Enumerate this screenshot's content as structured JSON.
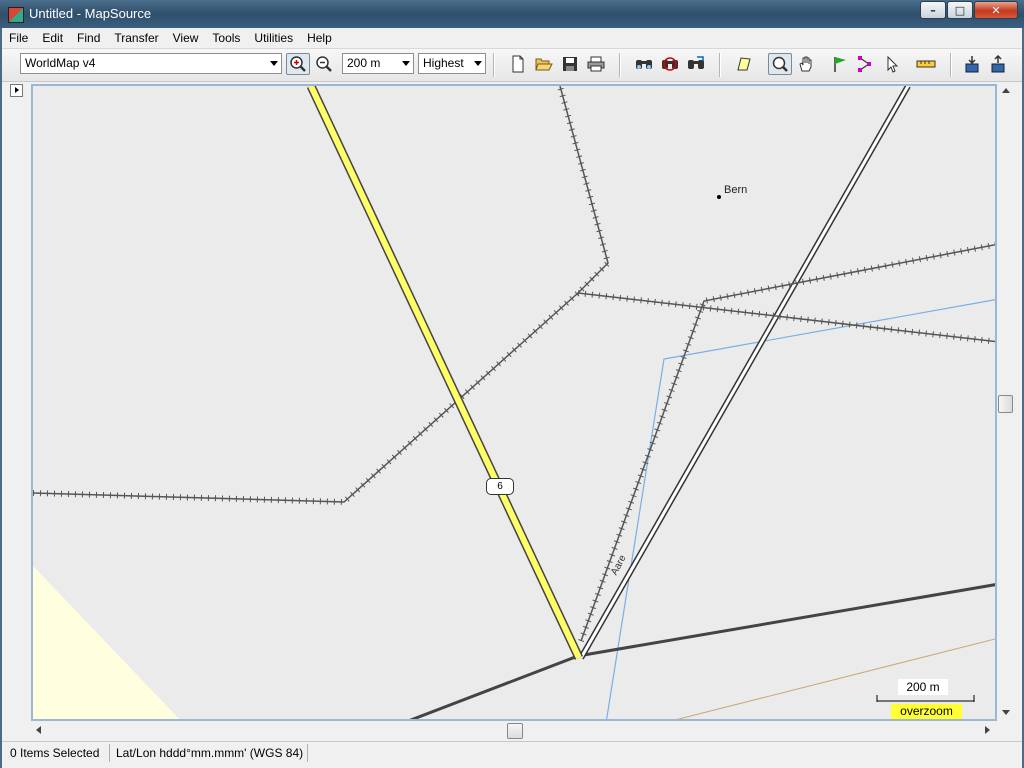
{
  "window": {
    "title": "Untitled - MapSource",
    "min_label": "–",
    "max_label": "□",
    "close_label": "✕"
  },
  "menu": {
    "items": [
      "File",
      "Edit",
      "Find",
      "Transfer",
      "View",
      "Tools",
      "Utilities",
      "Help"
    ]
  },
  "toolbar": {
    "product": "WorldMap v4",
    "zoom_scale": "200 m",
    "detail": "Highest",
    "icons": [
      "zoom-in-icon",
      "zoom-out-icon",
      "new-file-icon",
      "open-folder-icon",
      "save-icon",
      "print-icon",
      "find-icon",
      "find-nearest-icon",
      "find-route-icon",
      "map-tool-icon",
      "zoom-tool-icon",
      "hand-tool-icon",
      "waypoint-flag-icon",
      "route-tool-icon",
      "selection-arrow-icon",
      "distance-ruler-icon",
      "receive-from-device-icon",
      "send-to-device-icon"
    ]
  },
  "map": {
    "city_label": "Bern",
    "river_label": "Aare",
    "route_number": "6",
    "scale_label": "200 m",
    "overzoom_label": "overzoom",
    "colors": {
      "background": "#ebebeb",
      "major_road": "#ffff66",
      "railway": "#555555",
      "water_boundary": "#7aaee6",
      "land_zone": "#ffffe0",
      "brown_line": "#c8a87a",
      "dark_road": "#444444"
    }
  },
  "status": {
    "selected": "0 Items Selected",
    "coords_format": "Lat/Lon hddd°mm.mmm' (WGS 84)"
  }
}
